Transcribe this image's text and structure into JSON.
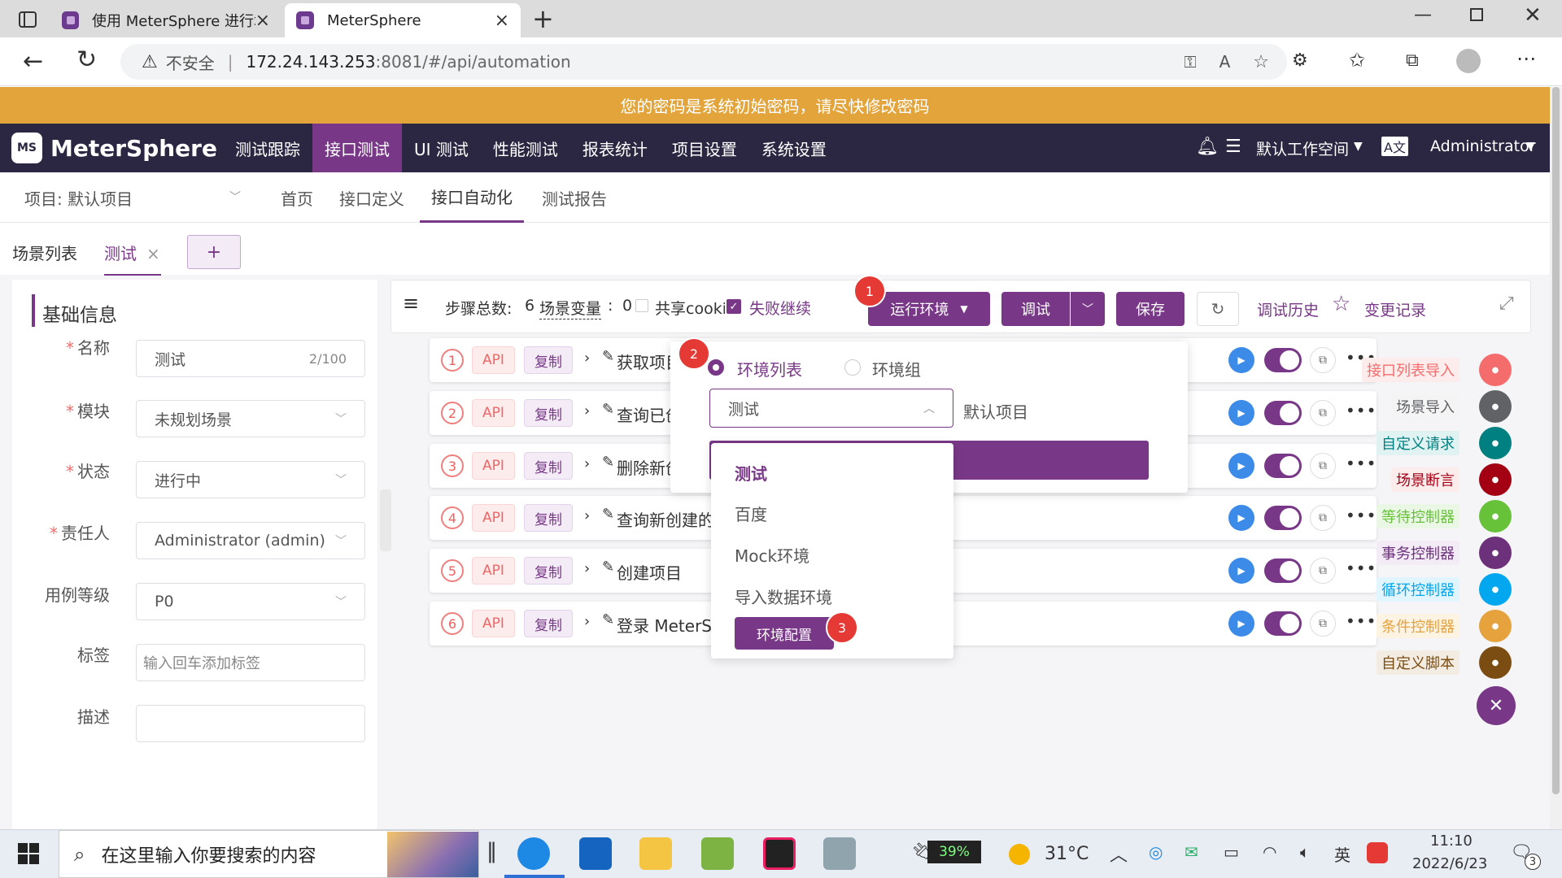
{
  "browser": {
    "tabs": [
      {
        "title": "使用 MeterSphere 进行场景化接"
      },
      {
        "title": "MeterSphere"
      }
    ],
    "security_label": "不安全",
    "url_host": "172.24.143.253",
    "url_rest": ":8081/#/api/automation"
  },
  "banner": {
    "text": "您的密码是系统初始密码，请尽快修改密码"
  },
  "app": {
    "logo": "MeterSphere",
    "nav": [
      "测试跟踪",
      "接口测试",
      "UI 测试",
      "性能测试",
      "报表统计",
      "项目设置",
      "系统设置"
    ],
    "workspace": "默认工作空间",
    "user": "Administrator"
  },
  "subnav": {
    "project": "项目: 默认项目",
    "items": [
      "首页",
      "接口定义",
      "接口自动化",
      "测试报告"
    ]
  },
  "scenario_tabs": {
    "list_label": "场景列表",
    "current": "测试",
    "add": "+"
  },
  "basic_info": {
    "title": "基础信息",
    "fields": [
      {
        "label": "名称",
        "required": true,
        "value": "测试",
        "counter": "2/100"
      },
      {
        "label": "模块",
        "required": true,
        "value": "未规划场景"
      },
      {
        "label": "状态",
        "required": true,
        "value": "进行中"
      },
      {
        "label": "责任人",
        "required": true,
        "value": "Administrator (admin)"
      },
      {
        "label": "用例等级",
        "required": false,
        "value": "P0"
      },
      {
        "label": "标签",
        "required": false,
        "placeholder": "输入回车添加标签"
      },
      {
        "label": "描述",
        "required": false,
        "value": ""
      }
    ]
  },
  "toolbar": {
    "steps_label": "步骤总数:",
    "steps_count": "6",
    "vars_label": "场景变量",
    "vars_count": "0",
    "share_cookie": "共享cooki",
    "fail_continue": "失败继续",
    "run_env": "运行环境",
    "debug": "调试",
    "save": "保存",
    "history": "调试历史",
    "changes": "变更记录"
  },
  "steps": [
    {
      "num": "1",
      "type": "API",
      "copy": "复制",
      "name": "获取项目"
    },
    {
      "num": "2",
      "type": "API",
      "copy": "复制",
      "name": "查询已创"
    },
    {
      "num": "3",
      "type": "API",
      "copy": "复制",
      "name": "删除新创"
    },
    {
      "num": "4",
      "type": "API",
      "copy": "复制",
      "name": "查询新创建的"
    },
    {
      "num": "5",
      "type": "API",
      "copy": "复制",
      "name": "创建项目"
    },
    {
      "num": "6",
      "type": "API",
      "copy": "复制",
      "name": "登录 MeterSp"
    }
  ],
  "env_popup": {
    "radio_list": "环境列表",
    "radio_group": "环境组",
    "selected_env": "测试",
    "project_label": "默认项目",
    "options": [
      "测试",
      "百度",
      "Mock环境",
      "导入数据环境"
    ],
    "config_button": "环境配置"
  },
  "markers": [
    "1",
    "2",
    "3"
  ],
  "right_tools": [
    {
      "label": "接口列表导入",
      "color": "#f56c6c"
    },
    {
      "label": "场景导入",
      "color": "#606266"
    },
    {
      "label": "自定义请求",
      "color": "#008080"
    },
    {
      "label": "场景断言",
      "color": "#a30014"
    },
    {
      "label": "等待控制器",
      "color": "#67c23a"
    },
    {
      "label": "事务控制器",
      "color": "#6d317c"
    },
    {
      "label": "循环控制器",
      "color": "#02a7f0"
    },
    {
      "label": "条件控制器",
      "color": "#e6a23c"
    },
    {
      "label": "自定义脚本",
      "color": "#7b4d12"
    }
  ],
  "taskbar": {
    "search_placeholder": "在这里输入你要搜索的内容",
    "battery": "39%",
    "weather": "31°C",
    "ime": "英",
    "time": "11:10",
    "date": "2022/6/23",
    "notifications": "3"
  }
}
